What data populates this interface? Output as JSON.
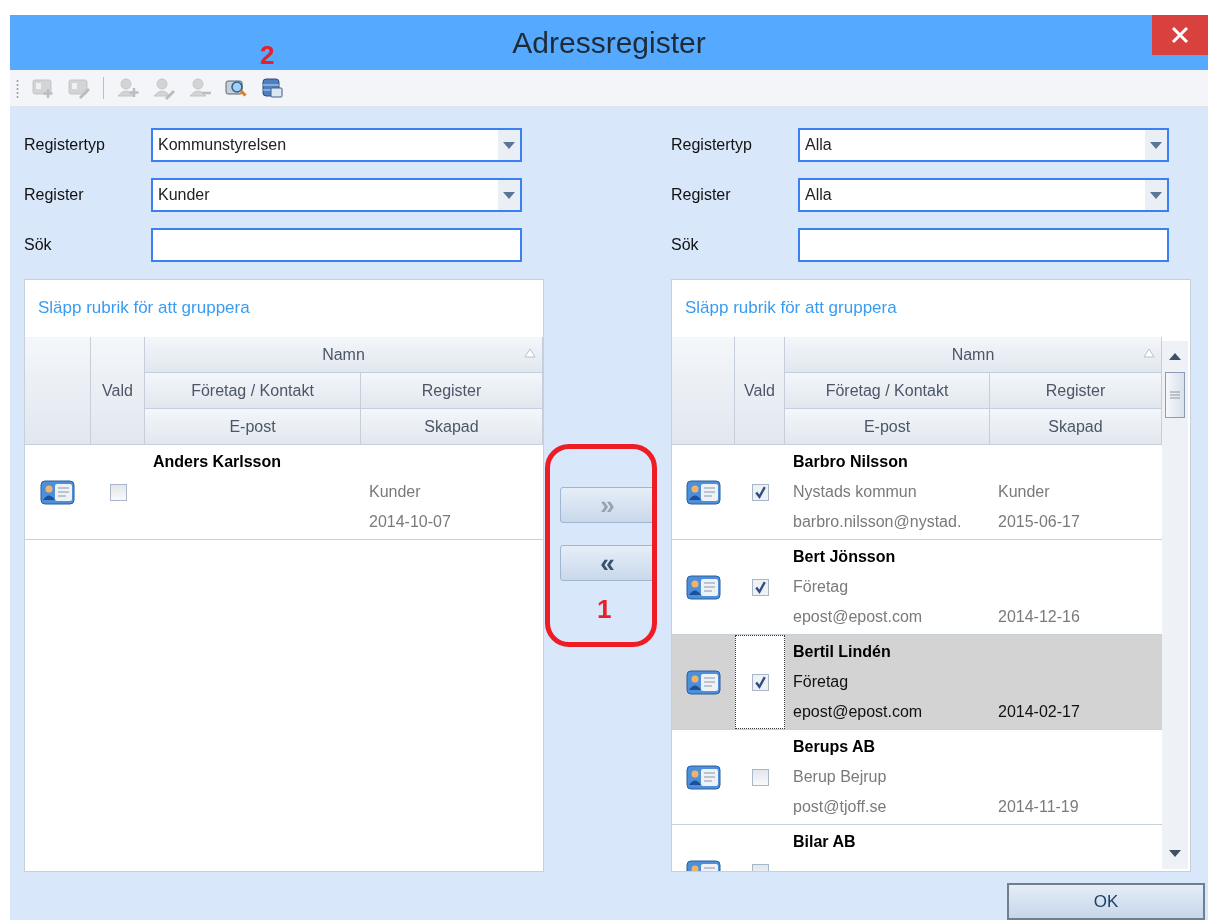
{
  "window": {
    "title": "Adressregister"
  },
  "toolbar": {
    "buttons": [
      {
        "kind": "card-add",
        "disabled": true
      },
      {
        "kind": "card-edit",
        "disabled": true
      },
      {
        "kind": "separator"
      },
      {
        "kind": "person-add",
        "disabled": true
      },
      {
        "kind": "person-edit",
        "disabled": true
      },
      {
        "kind": "person-remove",
        "disabled": true
      },
      {
        "kind": "search",
        "disabled": false
      },
      {
        "kind": "database",
        "disabled": false
      }
    ]
  },
  "panels": [
    {
      "filters": [
        {
          "label": "Registertyp",
          "kind": "dropdown",
          "value": "Kommunstyrelsen"
        },
        {
          "label": "Register",
          "kind": "dropdown",
          "value": "Kunder"
        },
        {
          "label": "Sök",
          "kind": "text"
        }
      ],
      "group_hint": "Släpp rubrik för att gruppera",
      "columns": {
        "checked": "Vald",
        "name": "Namn",
        "name_sorted": true,
        "company": "Företag / Kontakt",
        "register": "Register",
        "email": "E-post",
        "created": "Skapad"
      },
      "scrollbar": false,
      "rows": [
        {
          "name": "Anders Karlsson",
          "register": "Kunder",
          "created": "2014-10-07",
          "checked": false,
          "selected": false
        }
      ]
    },
    {
      "filters": [
        {
          "label": "Registertyp",
          "kind": "dropdown",
          "value": "Alla"
        },
        {
          "label": "Register",
          "kind": "dropdown",
          "value": "Alla"
        },
        {
          "label": "Sök",
          "kind": "text"
        }
      ],
      "group_hint": "Släpp rubrik för att gruppera",
      "columns": {
        "checked": "Vald",
        "name": "Namn",
        "name_sorted": true,
        "company": "Företag / Kontakt",
        "register": "Register",
        "email": "E-post",
        "created": "Skapad"
      },
      "scrollbar": true,
      "rows": [
        {
          "name": "Barbro Nilsson",
          "company": "Nystads kommun",
          "register": "Kunder",
          "email": "barbro.nilsson@nystad.",
          "created": "2015-06-17",
          "checked": true,
          "selected": false
        },
        {
          "name": "Bert Jönsson",
          "company": "Företag",
          "email": "epost@epost.com",
          "created": "2014-12-16",
          "checked": true,
          "selected": false
        },
        {
          "name": "Bertil Lindén",
          "company": "Företag",
          "email": "epost@epost.com",
          "created": "2014-02-17",
          "checked": true,
          "selected": true
        },
        {
          "name": "Berups AB",
          "company": "Berup Bejrup",
          "email": "post@tjoff.se",
          "created": "2014-11-19",
          "checked": false,
          "selected": false
        },
        {
          "name": "Bilar AB",
          "checked": false,
          "selected": false
        }
      ]
    }
  ],
  "transfer_buttons": [
    {
      "label": "»",
      "disabled": true
    },
    {
      "label": "«",
      "disabled": false
    }
  ],
  "ok_button": "OK",
  "annotations": [
    {
      "label": "1",
      "kind": "outline"
    },
    {
      "label": "2",
      "kind": "plain"
    }
  ]
}
